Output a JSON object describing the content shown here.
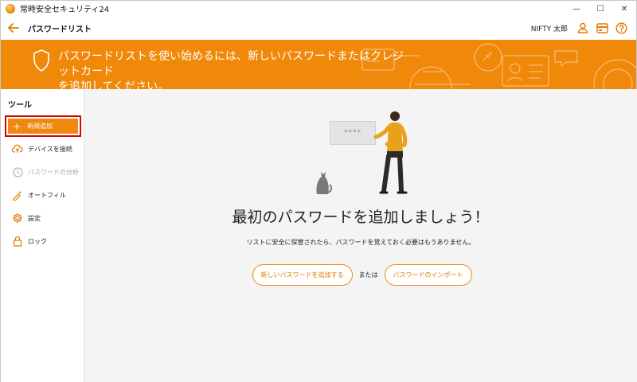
{
  "window": {
    "title": "常時安全セキュリティ24",
    "minimize_glyph": "—",
    "maximize_glyph": "☐",
    "close_glyph": "✕"
  },
  "header": {
    "page_title": "パスワードリスト",
    "user_name": "NIFTY 太郎"
  },
  "banner": {
    "message": "パスワードリストを使い始めるには、新しいパスワードまたはクレジットカード\nを追加してください。",
    "background_color": "#f0880a"
  },
  "sidebar": {
    "heading": "ツール",
    "new_button_label": "新規追加",
    "new_button_plus": "+",
    "items": [
      {
        "label": "デバイスを接続",
        "icon": "cloud-upload-icon",
        "disabled": false
      },
      {
        "label": "パスワードの分析",
        "icon": "clock-icon",
        "disabled": true
      },
      {
        "label": "オートフィル",
        "icon": "autofill-icon",
        "disabled": false
      },
      {
        "label": "設定",
        "icon": "gear-icon",
        "disabled": false
      },
      {
        "label": "ロック",
        "icon": "lock-icon",
        "disabled": false
      }
    ]
  },
  "main": {
    "card_mask": "****",
    "empty_title": "最初のパスワードを追加しましょう！",
    "empty_description": "リストに安全に保管されたら、パスワードを覚えておく必要はもうありません。",
    "add_button_label": "新しいパスワードを追加する",
    "or_text": "または",
    "import_button_label": "パスワードのインポート"
  },
  "colors": {
    "accent": "#ef8710",
    "highlight_border": "#d40000"
  }
}
